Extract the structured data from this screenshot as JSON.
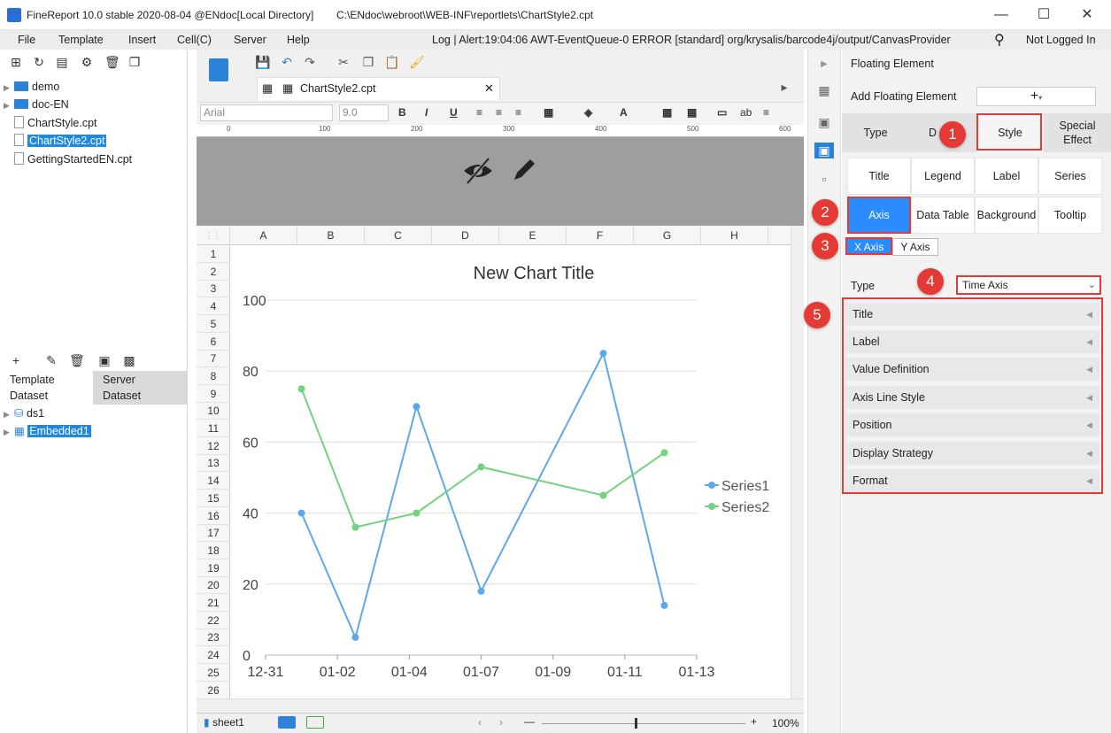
{
  "window": {
    "title": "FineReport 10.0 stable 2020-08-04 @ENdoc[Local Directory]",
    "path": "C:\\ENdoc\\webroot\\WEB-INF\\reportlets\\ChartStyle2.cpt",
    "minimize": "—",
    "maximize": "☐",
    "close": "✕"
  },
  "menu": {
    "items": [
      "File",
      "Template",
      "Insert",
      "Cell(C)",
      "Server",
      "Help"
    ],
    "log": "Log | Alert:19:04:06 AWT-EventQueue-0 ERROR [standard] org/krysalis/barcode4j/output/CanvasProvider",
    "login": "Not Logged In"
  },
  "file_tree": {
    "items": [
      {
        "label": "demo",
        "type": "folder"
      },
      {
        "label": "doc-EN",
        "type": "folder"
      },
      {
        "label": "ChartStyle.cpt",
        "type": "file"
      },
      {
        "label": "ChartStyle2.cpt",
        "type": "file",
        "selected": true
      },
      {
        "label": "GettingStartedEN.cpt",
        "type": "file"
      }
    ]
  },
  "dataset_panel": {
    "tab_template": "Template Dataset",
    "tab_template_l1": "Template",
    "tab_template_l2": "Dataset",
    "tab_server_l1": "Server",
    "tab_server_l2": "Dataset",
    "items": [
      "ds1",
      "Embedded1"
    ]
  },
  "editor": {
    "doc_tab": "ChartStyle2.cpt",
    "font": "Arial",
    "font_size": "9.0",
    "ruler_marks": [
      "0",
      "100",
      "200",
      "300",
      "400",
      "500",
      "600"
    ],
    "columns": [
      "A",
      "B",
      "C",
      "D",
      "E",
      "F",
      "G",
      "H"
    ],
    "rows": [
      "1",
      "2",
      "3",
      "4",
      "5",
      "6",
      "7",
      "8",
      "9",
      "10",
      "11",
      "12",
      "13",
      "14",
      "15",
      "16",
      "17",
      "18",
      "19",
      "20",
      "21",
      "22",
      "23",
      "24",
      "25",
      "26"
    ],
    "sheet_tab": "sheet1",
    "zoom": "100%"
  },
  "chart_data": {
    "type": "line",
    "title": "New Chart Title",
    "x": [
      "12-31",
      "01-02",
      "01-04",
      "01-07",
      "01-09",
      "01-11",
      "01-13"
    ],
    "ylim": [
      0,
      100
    ],
    "yticks": [
      0,
      20,
      40,
      60,
      80,
      100
    ],
    "series": [
      {
        "name": "Series1",
        "color": "#5fa8e8",
        "points": [
          [
            0.5,
            40
          ],
          [
            1.25,
            5
          ],
          [
            2.1,
            70
          ],
          [
            3.0,
            18
          ],
          [
            4.7,
            85
          ],
          [
            5.55,
            14
          ]
        ]
      },
      {
        "name": "Series2",
        "color": "#72d27d",
        "points": [
          [
            0.5,
            75
          ],
          [
            1.25,
            36
          ],
          [
            2.1,
            40
          ],
          [
            3.0,
            53
          ],
          [
            4.7,
            45
          ],
          [
            5.55,
            57
          ]
        ]
      }
    ],
    "legend": "right",
    "grid": true
  },
  "right_panel": {
    "header": "Floating Element",
    "add_label": "Add Floating Element",
    "add_button": "+",
    "top_tabs": [
      "Type",
      "Data",
      "Style",
      "Special Effect"
    ],
    "top_tab_data_short": "D",
    "special_l1": "Special",
    "special_l2": "Effect",
    "sub_tabs": [
      "Title",
      "Legend",
      "Label",
      "Series",
      "Axis",
      "Data Table",
      "Background",
      "Tooltip"
    ],
    "axis_tabs": [
      "X Axis",
      "Y Axis"
    ],
    "type_label": "Type",
    "type_value": "Time Axis",
    "sections": [
      "Title",
      "Label",
      "Value Definition",
      "Axis Line Style",
      "Position",
      "Display Strategy",
      "Format"
    ]
  },
  "annotations": [
    "1",
    "2",
    "3",
    "4",
    "5"
  ]
}
